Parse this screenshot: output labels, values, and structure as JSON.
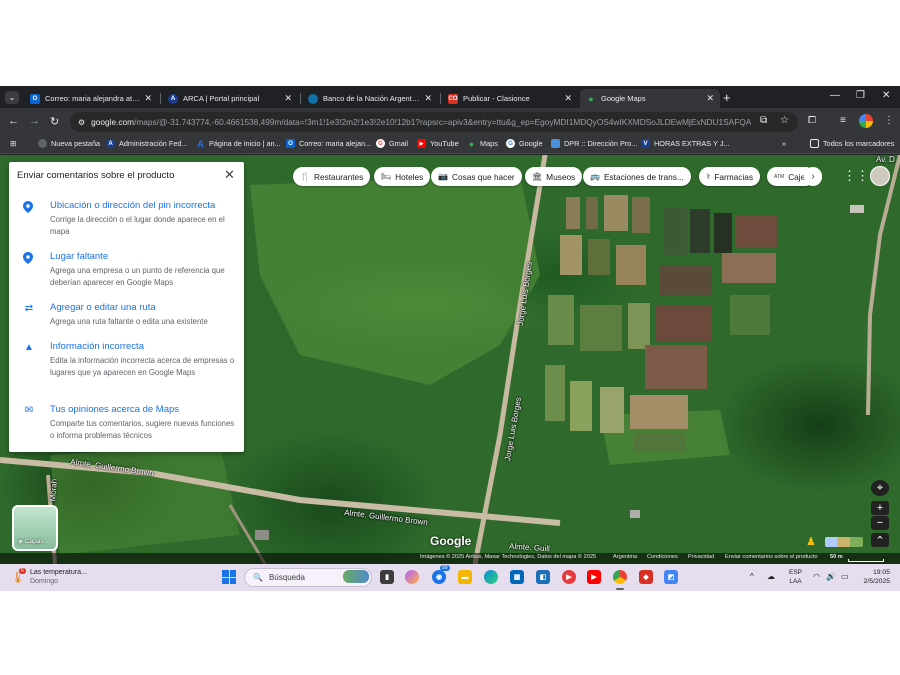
{
  "browser": {
    "tabs": [
      {
        "label": "Correo: maria alejandra atencio",
        "favicon_color": "#0a64d2",
        "favicon_glyph": "O"
      },
      {
        "label": "ARCA | Portal principal",
        "favicon_color": "#1a3f8f",
        "favicon_glyph": "A"
      },
      {
        "label": "Banco de la Nación Argentina",
        "favicon_color": "#0f6fa8",
        "favicon_glyph": ""
      },
      {
        "label": "Publicar - Clasionce",
        "favicon_color": "#d93025",
        "favicon_glyph": "CO"
      },
      {
        "label": "Google Maps",
        "favicon_color": "#34a853",
        "favicon_glyph": "",
        "active": true
      }
    ],
    "url_host": "google.com",
    "url_path": "/maps/@-31.743774,-60.4661538,499m/data=!3m1!1e3!2m2!1e3!2e10!12b1?rapsrc=apiv3&entry=ttu&g_ep=EgoyMDI1MDQyOS4wIKXMDSoJLDEwMjExNDU1SAFQAw...",
    "bookmarks": [
      {
        "label": "Nueva pestaña",
        "color": "#5f6368",
        "glyph": ""
      },
      {
        "label": "Administración Fed...",
        "color": "#1a3f8f",
        "glyph": "A"
      },
      {
        "label": "Página de inicio | an...",
        "color": "#1a73e8",
        "glyph": "A"
      },
      {
        "label": "Correo: maria alejan...",
        "color": "#0a64d2",
        "glyph": "O"
      },
      {
        "label": "Gmail",
        "color": "#ea4335",
        "glyph": "G"
      },
      {
        "label": "YouTube",
        "color": "#ff0000",
        "glyph": "▶"
      },
      {
        "label": "Maps",
        "color": "#34a853",
        "glyph": ""
      },
      {
        "label": "Google",
        "color": "#4285f4",
        "glyph": "G"
      },
      {
        "label": "DPR :: Dirección Pro...",
        "color": "#4a90d9",
        "glyph": ""
      },
      {
        "label": "HORAS EXTRAS Y J...",
        "color": "#1a3f8f",
        "glyph": "V"
      }
    ],
    "all_bookmarks": "Todos los marcadores"
  },
  "maps": {
    "chips": [
      {
        "label": "Restaurantes",
        "icon": "🍴"
      },
      {
        "label": "Hoteles",
        "icon": "🛏"
      },
      {
        "label": "Cosas que hacer",
        "icon": "📷"
      },
      {
        "label": "Museos",
        "icon": "🏛"
      },
      {
        "label": "Estaciones de trans...",
        "icon": "🚌"
      },
      {
        "label": "Farmacias",
        "icon": "⚕"
      },
      {
        "label": "Caje",
        "icon": "ATM"
      }
    ],
    "feedback": {
      "title": "Enviar comentarios sobre el producto",
      "items": [
        {
          "icon": "pin-icon",
          "glyph": "📍",
          "title": "Ubicación o dirección del pin incorrecta",
          "desc": "Corrige la dirección o el lugar donde aparece en el mapa"
        },
        {
          "icon": "pin-icon",
          "glyph": "📍",
          "title": "Lugar faltante",
          "desc": "Agrega una empresa o un punto de referencia que deberían aparecer en Google Maps"
        },
        {
          "icon": "route-icon",
          "glyph": "⇄",
          "title": "Agregar o editar una ruta",
          "desc": "Agrega una ruta faltante o edita una existente"
        },
        {
          "icon": "warning-icon",
          "glyph": "▲",
          "title": "Información incorrecta",
          "desc": "Edita la información incorrecta acerca de empresas o lugares que ya aparecen en Google Maps"
        },
        {
          "icon": "mail-icon",
          "glyph": "✉",
          "title": "Tus opiniones acerca de Maps",
          "desc": "Comparte tus comentarios, sugiere nuevas funciones o informa problemas técnicos"
        }
      ]
    },
    "road_labels": {
      "jorge1": "Jorge Luis Borges",
      "jorge2": "Jorge Luis Borges",
      "brown1": "Almte. Guillermo Brown",
      "brown2": "Almte. Guillermo Brown",
      "brown3": "Almte. Guill",
      "av": "Av. D",
      "morales": "Morah"
    },
    "layers_label": "Capas",
    "logo": "Google",
    "attribution": {
      "imagery": "Imágenes © 2025 Airbus, Maxar Technologies, Datos del mapa © 2025",
      "country": "Argentina",
      "terms": "Condiciones",
      "privacy": "Privacidad",
      "feedback": "Enviar comentarios sobre el producto",
      "scale": "50 m"
    }
  },
  "taskbar": {
    "weather_title": "Las temperatura...",
    "weather_sub": "Domingo",
    "search_placeholder": "Búsqueda",
    "lang_1": "ESP",
    "lang_2": "LAA",
    "time": "19:05",
    "date": "2/5/2025",
    "badge": "99",
    "weather_badge": "6"
  }
}
